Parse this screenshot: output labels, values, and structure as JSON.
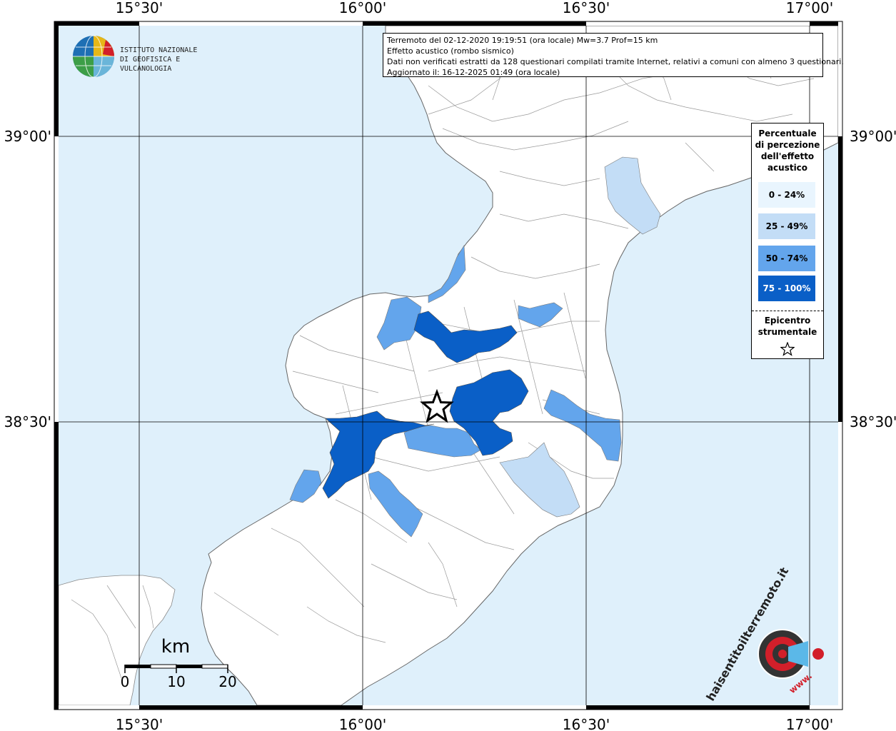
{
  "header": {
    "line1": "Terremoto del 02-12-2020 19:19:51 (ora locale) Mw=3.7 Prof=15 km",
    "line2": "Effetto acustico (rombo sismico)",
    "line3": "Dati non verificati estratti da 128 questionari compilati tramite Internet, relativi a comuni con almeno 3 questionari.",
    "line4": "Aggiornato il: 16-12-2025 01:49 (ora locale)"
  },
  "logo": {
    "line1": "ISTITUTO NAZIONALE",
    "line2": "DI GEOFISICA E VULCANOLOGIA"
  },
  "axes": {
    "lon_labels": [
      "15°30'",
      "16°00'",
      "16°30'",
      "17°00'"
    ],
    "lat_labels": [
      "39°00'",
      "38°30'"
    ]
  },
  "legend": {
    "title": "Percentuale di percezione dell'effetto acustico",
    "title_lines": [
      "Percentuale",
      "di percezione",
      "dell'effetto",
      "acustico"
    ],
    "items": [
      {
        "label": "0 - 24%",
        "color": "#e9f5fe",
        "text_color": "#000000"
      },
      {
        "label": "25 - 49%",
        "color": "#c3ddf6",
        "text_color": "#000000"
      },
      {
        "label": "50 - 74%",
        "color": "#63a5ec",
        "text_color": "#000000"
      },
      {
        "label": "75 - 100%",
        "color": "#0a5fc7",
        "text_color": "#ffffff"
      }
    ],
    "epicenter_lines": [
      "Epicentro",
      "strumentale"
    ]
  },
  "scale": {
    "unit": "km",
    "labels": [
      "0",
      "10",
      "20"
    ]
  },
  "watermark": {
    "text": "haisentitoilterremoto.it",
    "prefix": "www."
  },
  "colors": {
    "sea": "#dff0fb",
    "land": "#ffffff",
    "level1": "#e9f5fe",
    "level2": "#c3ddf6",
    "level3": "#63a5ec",
    "level4": "#0a5fc7"
  }
}
